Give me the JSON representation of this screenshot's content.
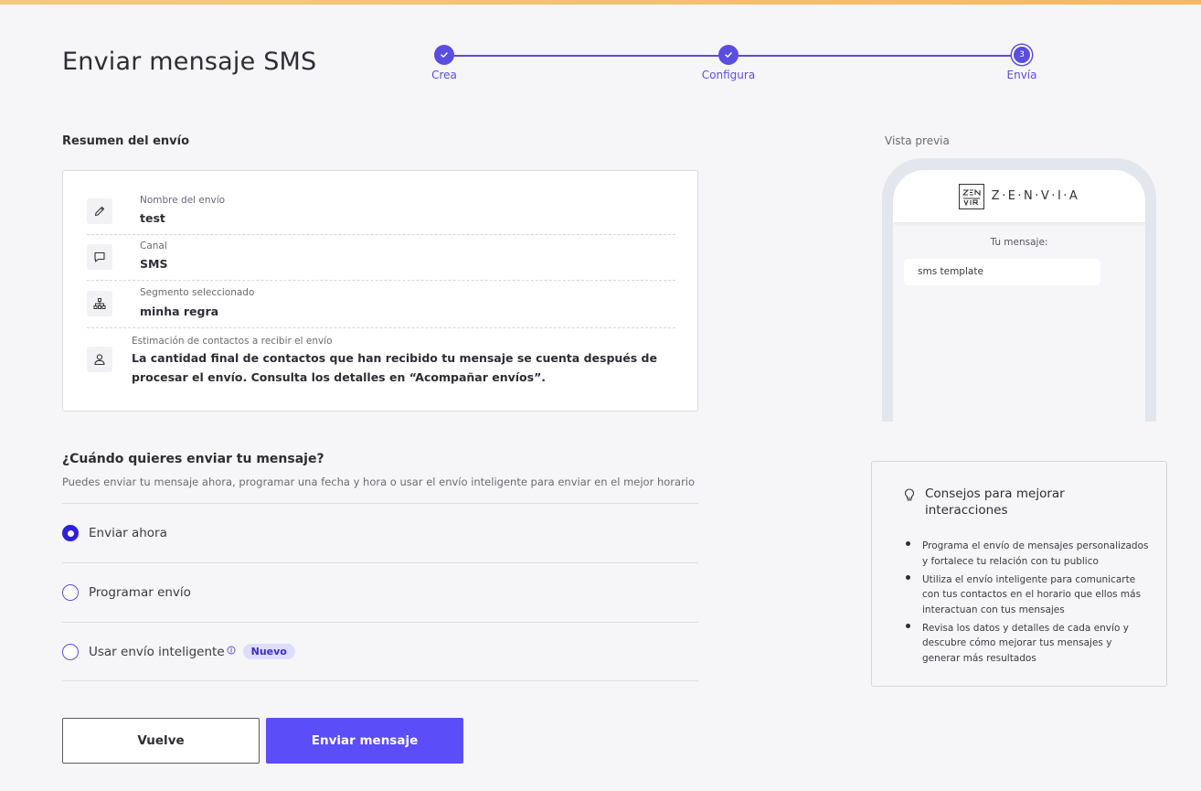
{
  "page": {
    "title": "Enviar mensaje SMS"
  },
  "stepper": {
    "steps": [
      {
        "label": "Crea",
        "state": "done"
      },
      {
        "label": "Configura",
        "state": "done"
      },
      {
        "label": "Envía",
        "state": "current",
        "number": "3"
      }
    ],
    "accent_color": "#5b4de0"
  },
  "summary": {
    "title": "Resumen del envío",
    "rows": [
      {
        "icon": "pencil-icon",
        "label": "Nombre del envío",
        "value": "test"
      },
      {
        "icon": "chat-icon",
        "label": "Canal",
        "value": "SMS"
      },
      {
        "icon": "hierarchy-icon",
        "label": "Segmento seleccionado",
        "value": "minha regra"
      },
      {
        "icon": "user-icon",
        "label": "Estimación de contactos a recibir el envío",
        "value": "La cantidad final de contactos que han recibido tu mensaje se cuenta después de procesar el envío. Consulta los detalles en “Acompañar envíos”."
      }
    ]
  },
  "schedule": {
    "title": "¿Cuándo quieres enviar tu mensaje?",
    "description": "Puedes enviar tu mensaje ahora, programar una fecha y hora o usar el envío inteligente para enviar en el mejor horario",
    "options": [
      {
        "label": "Enviar ahora",
        "checked": true
      },
      {
        "label": "Programar envío",
        "checked": false
      },
      {
        "label": "Usar envío inteligente",
        "checked": false,
        "badge": "Nuevo"
      }
    ]
  },
  "buttons": {
    "back": "Vuelve",
    "send": "Enviar mensaje"
  },
  "preview": {
    "label": "Vista previa",
    "brand": "Z·E·N·V·I·A",
    "message_label": "Tu mensaje:",
    "message": "sms template"
  },
  "tips": {
    "title": "Consejos para mejorar interacciones",
    "items": [
      "Programa el envío de mensajes personalizados y fortalece tu relación con tu publico",
      "Utiliza el envío inteligente para comunicarte con tus contactos en el horario que ellos más interactuan con tus mensajes",
      "Revisa los datos y detalles de cada envío y descubre cómo mejorar tus mensajes y generar más resultados"
    ]
  }
}
